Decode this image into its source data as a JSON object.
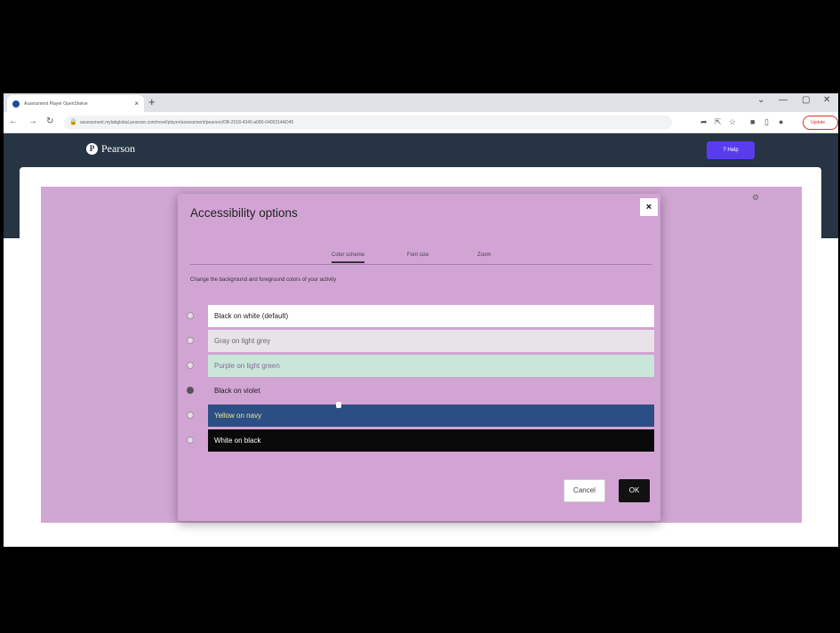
{
  "browser": {
    "tab_title": "Assessment Player OpenShelve",
    "tab_close": "×",
    "new_tab": "+",
    "window_controls": [
      "⌄",
      "—",
      "▢",
      "✕"
    ],
    "url": "assessment.mylabglobal.pearson.com/revel/player/assessment/pearson/DB-2018-4340-a080-0400314AD45",
    "update_label": "Update"
  },
  "page": {
    "brand": "Pearson",
    "help_label": "Help"
  },
  "dialog": {
    "title": "Accessibility options",
    "close_label": "×",
    "tabs": [
      {
        "label": "Color scheme",
        "active": true
      },
      {
        "label": "Font size",
        "active": false
      },
      {
        "label": "Zoom",
        "active": false
      }
    ],
    "description": "Change the background and foreground colors of your activity",
    "options": [
      {
        "label": "Black on white (default)",
        "bg": "#ffffff",
        "fg": "#222222",
        "checked": false
      },
      {
        "label": "Gray on light grey",
        "bg": "#e8e3e8",
        "fg": "#666666",
        "checked": false
      },
      {
        "label": "Purple on light green",
        "bg": "#c9e6d8",
        "fg": "#8a6a9c",
        "checked": false
      },
      {
        "label": "Black on violet",
        "bg": "#d2a4d4",
        "fg": "#222222",
        "checked": true
      },
      {
        "label": "Yellow on navy",
        "bg": "#2b4f85",
        "fg": "#f0e68c",
        "checked": false
      },
      {
        "label": "White on black",
        "bg": "#0a0a0a",
        "fg": "#ffffff",
        "checked": false
      }
    ],
    "cancel_label": "Cancel",
    "ok_label": "OK"
  }
}
